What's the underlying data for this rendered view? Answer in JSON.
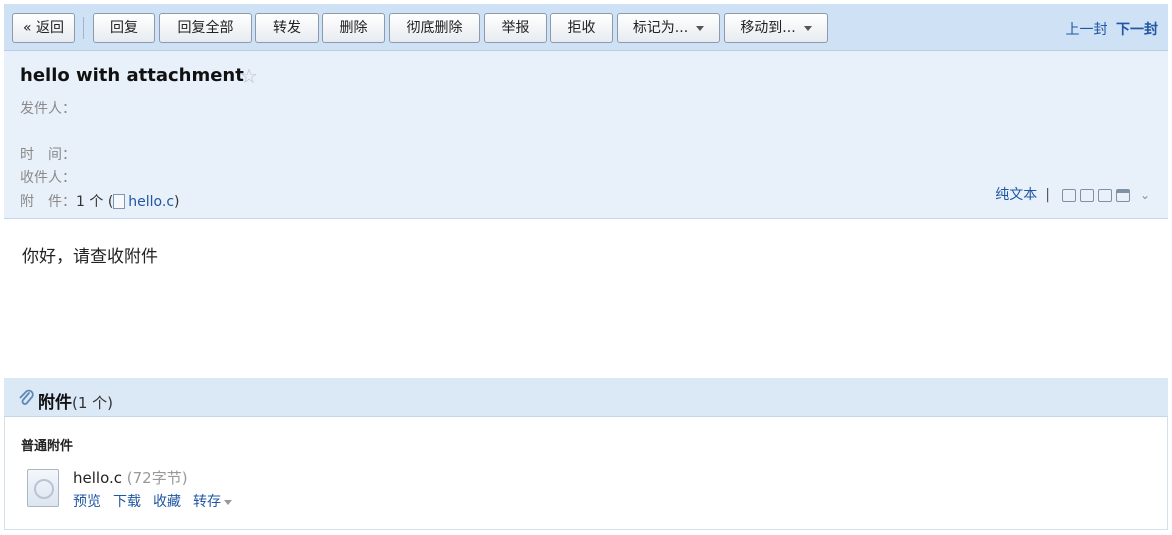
{
  "toolbar": {
    "back": "« 返回",
    "reply": "回复",
    "reply_all": "回复全部",
    "forward": "转发",
    "delete": "删除",
    "delete_permanent": "彻底删除",
    "report": "举报",
    "reject": "拒收",
    "mark_as": "标记为...",
    "move_to": "移动到...",
    "prev": "上一封",
    "next": "下一封"
  },
  "email": {
    "subject": "hello with attachment",
    "labels": {
      "from": "发件人：",
      "time": "时　间：",
      "to": "收件人：",
      "attachments": "附　件："
    },
    "attachment_summary": {
      "count": "1 个",
      "open_paren": "(",
      "file": "hello.c",
      "close_paren": ")"
    },
    "plain_text_link": "纯文本",
    "body": "你好，请查收附件"
  },
  "attachments": {
    "title": "附件",
    "count": "(1 个)",
    "subtitle": "普通附件",
    "items": [
      {
        "name": "hello.c",
        "size": "(72字节)",
        "actions": {
          "preview": "预览",
          "download": "下载",
          "favorite": "收藏",
          "save_to": "转存"
        }
      }
    ]
  },
  "colors": {
    "toolbar_bg": "#cfe1f5",
    "header_bg": "#e8f0fa",
    "link": "#1f57a4"
  }
}
